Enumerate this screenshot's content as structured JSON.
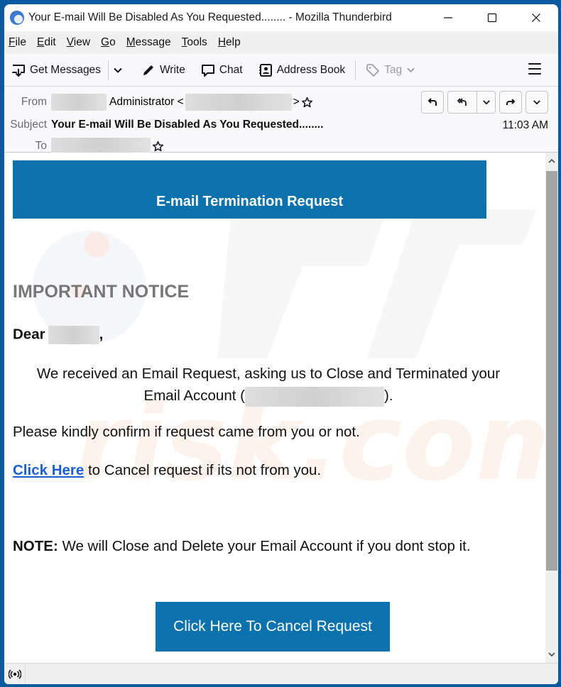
{
  "window": {
    "title": "Your E-mail Will Be Disabled As You Requested........ - Mozilla Thunderbird",
    "controls": [
      "minimize",
      "maximize",
      "close"
    ]
  },
  "menubar": {
    "items": [
      {
        "label": "File",
        "accel": "F",
        "rest": "ile"
      },
      {
        "label": "Edit",
        "accel": "E",
        "rest": "dit"
      },
      {
        "label": "View",
        "accel": "V",
        "rest": "iew"
      },
      {
        "label": "Go",
        "accel": "G",
        "rest": "o"
      },
      {
        "label": "Message",
        "accel": "M",
        "rest": "essage"
      },
      {
        "label": "Tools",
        "accel": "T",
        "rest": "ools"
      },
      {
        "label": "Help",
        "accel": "H",
        "rest": "elp"
      }
    ]
  },
  "toolbar": {
    "get_messages": "Get Messages",
    "write": "Write",
    "chat": "Chat",
    "address_book": "Address Book",
    "tag": "Tag"
  },
  "header": {
    "from_label": "From",
    "from_name": "Administrator <",
    "from_close": ">",
    "subject_label": "Subject",
    "subject": "Your E-mail Will Be Disabled As You Requested........",
    "to_label": "To",
    "time": "11:03 AM",
    "actions": [
      "reply",
      "reply-all",
      "reply-all-menu",
      "forward",
      "more"
    ]
  },
  "email": {
    "banner_title": "E-mail Termination Request",
    "notice": "IMPORTANT NOTICE",
    "greeting": "Dear",
    "greeting_comma": ",",
    "para1_line1": "We received an Email Request, asking us to Close and Terminated your",
    "para1_line2_start": "Email Account (",
    "para1_line2_end": ").",
    "confirm": "Please kindly confirm if request came from you or not.",
    "link_text": "Click Here",
    "link_rest": " to Cancel request if its not from you.",
    "note_label": "NOTE:",
    "note_text": " We will Close and Delete your Email Account if you dont stop it.",
    "cta_button": "Click Here To Cancel Request",
    "brand_color": "#0b72ad",
    "link_color": "#1a5fd6"
  },
  "statusbar": {
    "icon": "online-status-icon"
  }
}
